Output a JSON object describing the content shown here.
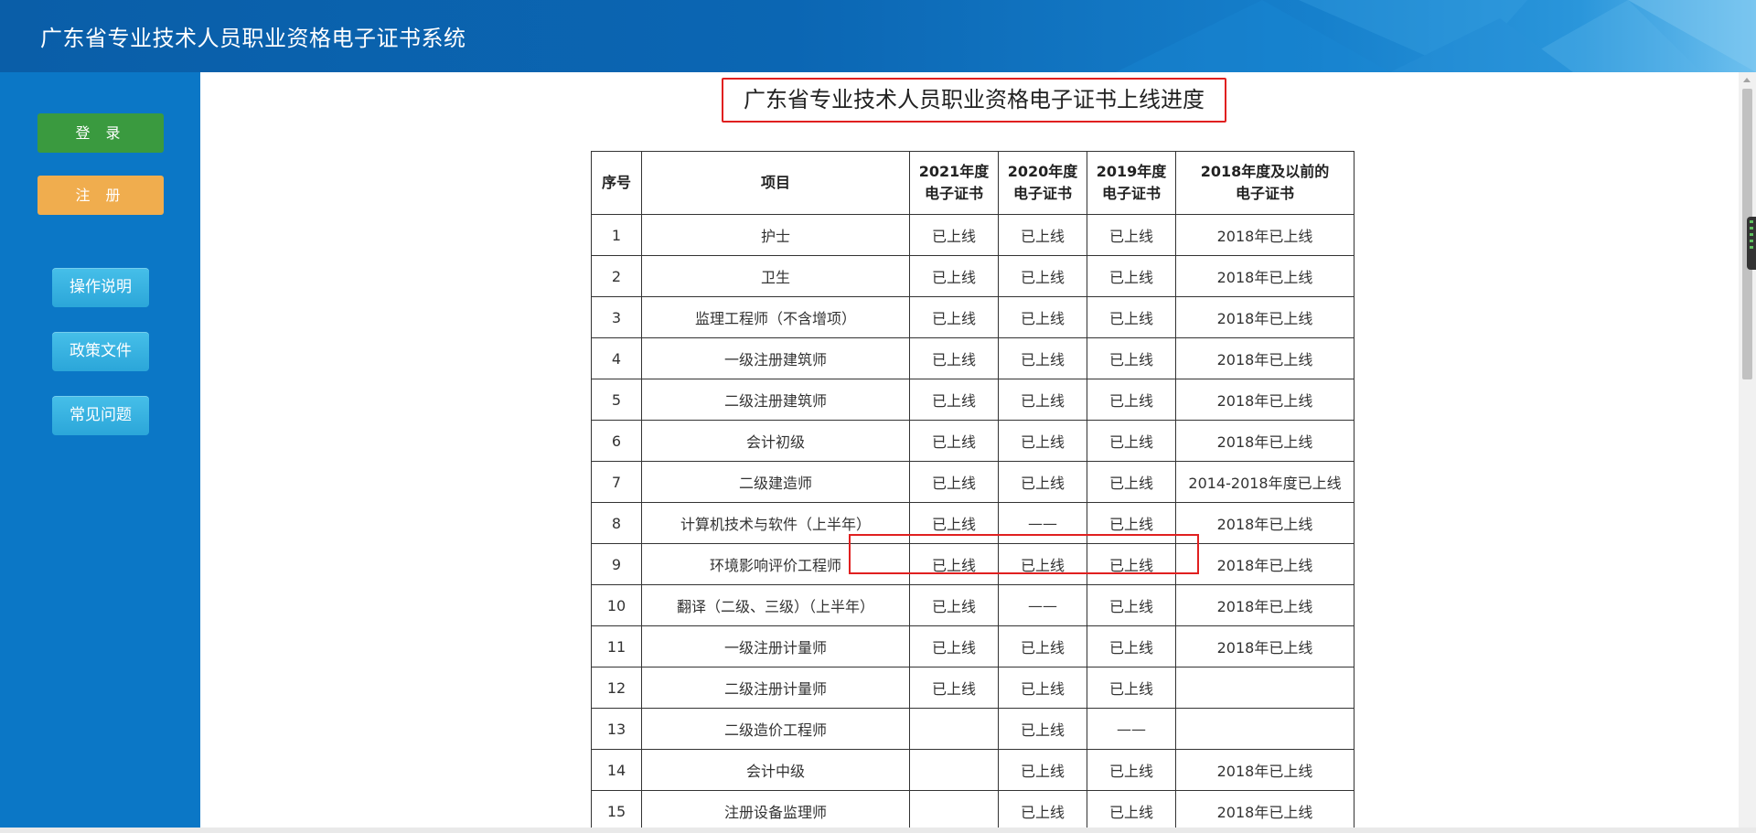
{
  "header": {
    "title": "广东省专业技术人员职业资格电子证书系统"
  },
  "sidebar": {
    "login": "登 录",
    "register": "注 册",
    "guide": "操作说明",
    "policy": "政策文件",
    "faq": "常见问题"
  },
  "main": {
    "title": "广东省专业技术人员职业资格电子证书上线进度",
    "table": {
      "headers": [
        "序号",
        "项目",
        "2021年度\n电子证书",
        "2020年度\n电子证书",
        "2019年度\n电子证书",
        "2018年度及以前的\n电子证书"
      ],
      "rows": [
        [
          "1",
          "护士",
          "已上线",
          "已上线",
          "已上线",
          "2018年已上线"
        ],
        [
          "2",
          "卫生",
          "已上线",
          "已上线",
          "已上线",
          "2018年已上线"
        ],
        [
          "3",
          "监理工程师（不含增项）",
          "已上线",
          "已上线",
          "已上线",
          "2018年已上线"
        ],
        [
          "4",
          "一级注册建筑师",
          "已上线",
          "已上线",
          "已上线",
          "2018年已上线"
        ],
        [
          "5",
          "二级注册建筑师",
          "已上线",
          "已上线",
          "已上线",
          "2018年已上线"
        ],
        [
          "6",
          "会计初级",
          "已上线",
          "已上线",
          "已上线",
          "2018年已上线"
        ],
        [
          "7",
          "二级建造师",
          "已上线",
          "已上线",
          "已上线",
          "2014-2018年度已上线"
        ],
        [
          "8",
          "计算机技术与软件（上半年）",
          "已上线",
          "——",
          "已上线",
          "2018年已上线"
        ],
        [
          "9",
          "环境影响评价工程师",
          "已上线",
          "已上线",
          "已上线",
          "2018年已上线"
        ],
        [
          "10",
          "翻译（二级、三级）（上半年）",
          "已上线",
          "——",
          "已上线",
          "2018年已上线"
        ],
        [
          "11",
          "一级注册计量师",
          "已上线",
          "已上线",
          "已上线",
          "2018年已上线"
        ],
        [
          "12",
          "二级注册计量师",
          "已上线",
          "已上线",
          "已上线",
          ""
        ],
        [
          "13",
          "二级造价工程师",
          "",
          "已上线",
          "——",
          ""
        ],
        [
          "14",
          "会计中级",
          "",
          "已上线",
          "已上线",
          "2018年已上线"
        ],
        [
          "15",
          "注册设备监理师",
          "",
          "已上线",
          "已上线",
          "2018年已上线"
        ]
      ]
    }
  }
}
